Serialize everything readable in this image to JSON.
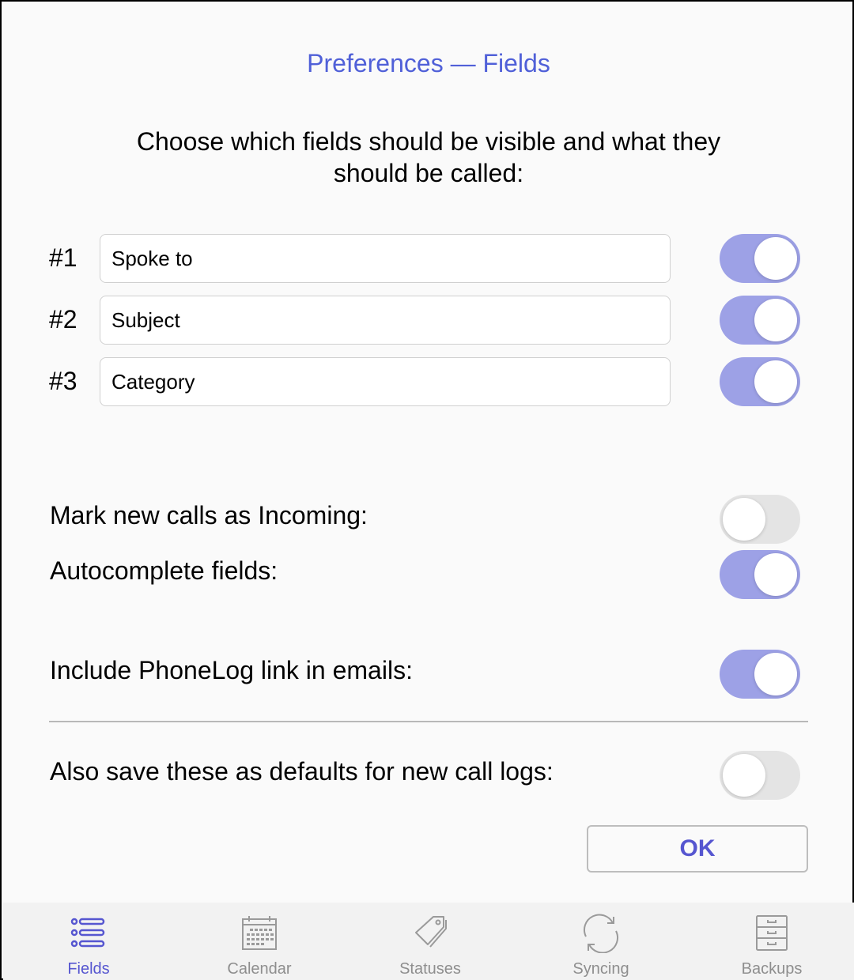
{
  "header": {
    "title": "Preferences — Fields"
  },
  "intro_text": "Choose which fields should be visible and what they should be called:",
  "fields": [
    {
      "number": "#1",
      "value": "Spoke to",
      "visible": true
    },
    {
      "number": "#2",
      "value": "Subject",
      "visible": true
    },
    {
      "number": "#3",
      "value": "Category",
      "visible": true
    }
  ],
  "options": [
    {
      "label": "Mark new calls as Incoming:",
      "enabled": false
    },
    {
      "label": "Autocomplete fields:",
      "enabled": true
    },
    {
      "label": "Include PhoneLog link in emails:",
      "enabled": true
    },
    {
      "label": "Also save these as defaults for new call logs:",
      "enabled": false
    }
  ],
  "ok_button": {
    "label": "OK"
  },
  "tabbar": {
    "tabs": [
      {
        "label": "Fields",
        "icon": "list-icon",
        "active": true
      },
      {
        "label": "Calendar",
        "icon": "calendar-icon",
        "active": false
      },
      {
        "label": "Statuses",
        "icon": "tags-icon",
        "active": false
      },
      {
        "label": "Syncing",
        "icon": "sync-icon",
        "active": false
      },
      {
        "label": "Backups",
        "icon": "cabinet-icon",
        "active": false
      }
    ]
  },
  "colors": {
    "accent": "#5656d0",
    "title": "#5060d8",
    "toggle_on": "#9da1e6",
    "toggle_off": "#e4e4e4",
    "tab_inactive": "#8e8e8e"
  }
}
